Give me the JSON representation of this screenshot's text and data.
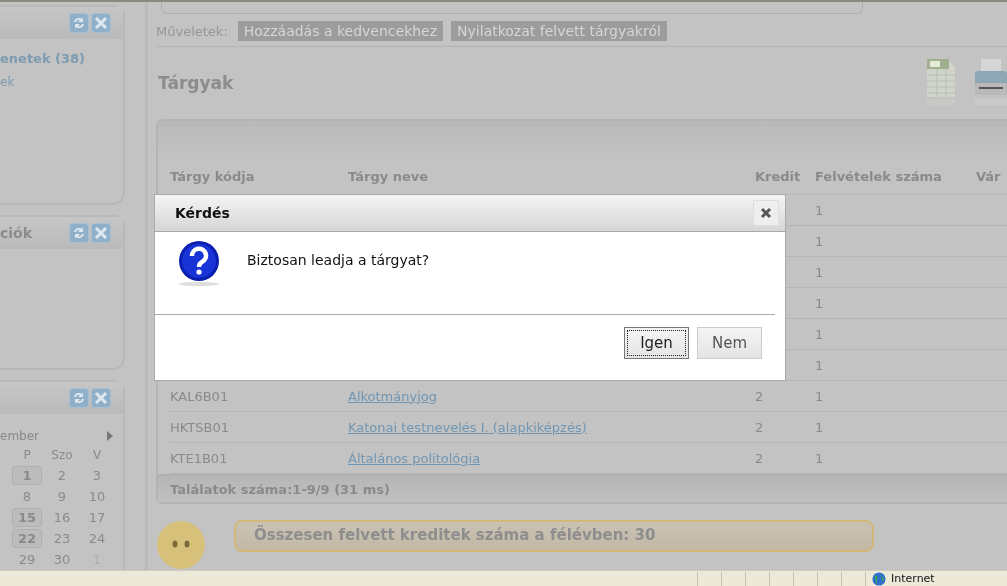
{
  "sidebar": {
    "panels": [
      {
        "kind": "list",
        "items": [
          {
            "label": "enetek (38)",
            "bold": true
          },
          {
            "label": "ek",
            "bold": false
          }
        ]
      },
      {
        "kind": "list",
        "title": "ciók"
      },
      {
        "kind": "calendar",
        "month": "ember",
        "weekdays": [
          "P",
          "Szo",
          "V"
        ],
        "weeks": [
          [
            {
              "day": "1",
              "marked": true,
              "other_month": false
            },
            {
              "day": "2",
              "marked": false,
              "other_month": false
            },
            {
              "day": "3",
              "marked": false,
              "other_month": false
            }
          ],
          [
            {
              "day": "8",
              "marked": false,
              "other_month": false
            },
            {
              "day": "9",
              "marked": false,
              "other_month": false
            },
            {
              "day": "10",
              "marked": false,
              "other_month": false
            }
          ],
          [
            {
              "day": "15",
              "marked": true,
              "other_month": false
            },
            {
              "day": "16",
              "marked": false,
              "other_month": false
            },
            {
              "day": "17",
              "marked": false,
              "other_month": false
            }
          ],
          [
            {
              "day": "22",
              "marked": true,
              "other_month": false
            },
            {
              "day": "23",
              "marked": false,
              "other_month": false
            },
            {
              "day": "24",
              "marked": false,
              "other_month": false
            }
          ],
          [
            {
              "day": "29",
              "marked": false,
              "other_month": false
            },
            {
              "day": "30",
              "marked": false,
              "other_month": false
            },
            {
              "day": "1",
              "marked": false,
              "other_month": true
            }
          ]
        ]
      }
    ]
  },
  "actions": {
    "label": "Műveletek:",
    "buttons": [
      "Hozzáadás a kedvencekhez",
      "Nyilatkozat felvett tárgyakról"
    ]
  },
  "section_title": "Tárgyak",
  "table": {
    "columns": [
      "Tárgy kódja",
      "Tárgy neve",
      "Kredit",
      "Felvételek száma",
      "Vár"
    ],
    "rows": [
      {
        "felvetelek": "1"
      },
      {
        "felvetelek": "1"
      },
      {
        "felvetelek": "1"
      },
      {
        "felvetelek": "1"
      },
      {
        "felvetelek": "1"
      },
      {
        "felvetelek": "1"
      },
      {
        "code": "KAL6B01",
        "name": "Alkotmányjog",
        "kredit": "2",
        "felvetelek": "1"
      },
      {
        "code": "HKTSB01",
        "name": "Katonai testnevelés I. (alapkiképzés)",
        "kredit": "2",
        "felvetelek": "1"
      },
      {
        "code": "KTE1B01",
        "name": "Általános politológia",
        "kredit": "2",
        "felvetelek": "1"
      }
    ],
    "footer": "Találatok száma:1-9/9 (31 ms)"
  },
  "summary": "Összesen felvett kreditek száma a félévben: 30",
  "dialog": {
    "title": "Kérdés",
    "message": "Biztosan leadja a tárgyat?",
    "buttons": [
      {
        "label": "Igen",
        "focused": true
      },
      {
        "label": "Nem",
        "focused": false
      }
    ]
  },
  "status_bar": {
    "zone": "Internet"
  }
}
